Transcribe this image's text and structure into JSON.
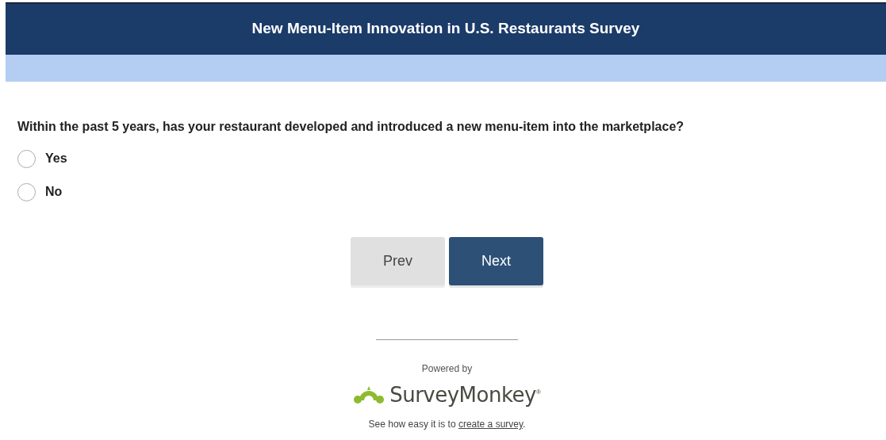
{
  "header": {
    "title": "New Menu-Item Innovation in U.S. Restaurants Survey"
  },
  "question": {
    "text": "Within the past 5 years, has your restaurant developed and introduced a new menu-item into the marketplace?",
    "options": [
      {
        "label": "Yes",
        "selected": false
      },
      {
        "label": "No",
        "selected": false
      }
    ]
  },
  "buttons": [
    {
      "label": "Prev",
      "kind": "secondary"
    },
    {
      "label": "Next",
      "kind": "primary"
    }
  ],
  "footer": {
    "powered_by": "Powered by",
    "brand": "SurveyMonkey",
    "brand_mark": "®",
    "tagline": "See how easy it is to ",
    "link": "create a survey",
    "tagline_end": "."
  }
}
